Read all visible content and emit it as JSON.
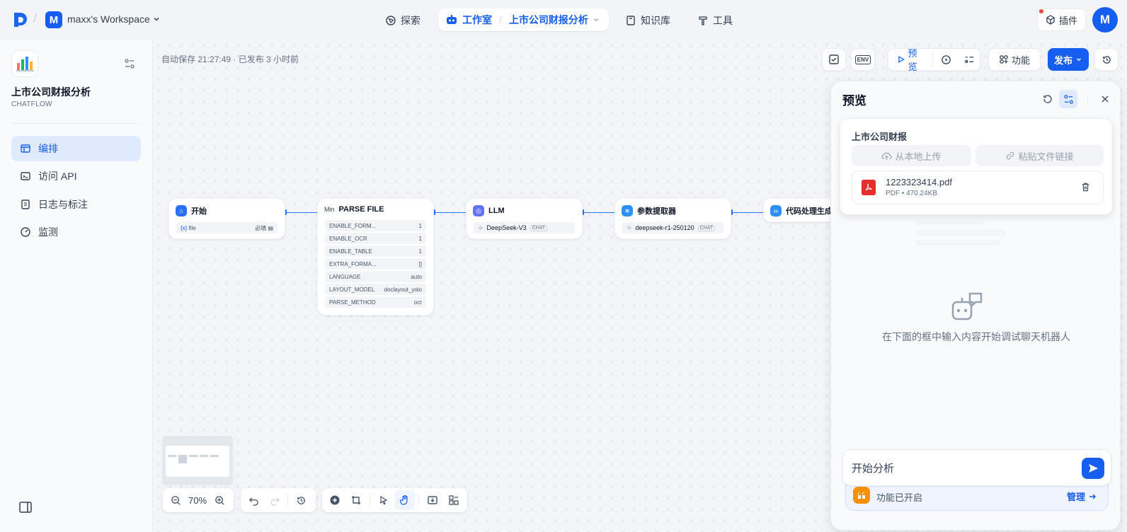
{
  "header": {
    "workspace_initial": "M",
    "workspace_name": "maxx's Workspace",
    "nav": {
      "explore": "探索",
      "studio": "工作室",
      "app_name": "上市公司财报分析",
      "knowledge": "知识库",
      "tools": "工具"
    },
    "plugin_label": "插件",
    "avatar_initial": "M"
  },
  "sidebar": {
    "app_title": "上市公司财报分析",
    "app_type": "CHATFLOW",
    "items": [
      {
        "label": "编排",
        "icon": "layout-icon"
      },
      {
        "label": "访问 API",
        "icon": "terminal-icon"
      },
      {
        "label": "日志与标注",
        "icon": "file-list-icon"
      },
      {
        "label": "监测",
        "icon": "dashboard-icon"
      }
    ]
  },
  "canvas": {
    "autosave": "自动保存 21:27:49 · 已发布 3 小时前",
    "toolbar": {
      "env": "ENV",
      "preview": "预览",
      "features": "功能",
      "publish": "发布"
    },
    "zoom": "70%"
  },
  "nodes": {
    "start": {
      "title": "开始",
      "var_prefix": "{x}",
      "var_name": "file",
      "required": "必填"
    },
    "parse": {
      "title": "PARSE FILE",
      "icon_text": "Min",
      "params": [
        {
          "key": "ENABLE_FORM...",
          "value": "1"
        },
        {
          "key": "ENABLE_OCR",
          "value": "1"
        },
        {
          "key": "ENABLE_TABLE",
          "value": "1"
        },
        {
          "key": "EXTRA_FORMA...",
          "value": "[]"
        },
        {
          "key": "LANGUAGE",
          "value": "auto"
        },
        {
          "key": "LAYOUT_MODEL",
          "value": "doclayout_yolo"
        },
        {
          "key": "PARSE_METHOD",
          "value": "ocr"
        }
      ]
    },
    "llm": {
      "title": "LLM",
      "model": "DeepSeek-V3",
      "tag": "CHAT"
    },
    "extractor": {
      "title": "参数提取器",
      "model": "deepseek-r1-250120",
      "tag": "CHAT"
    },
    "code": {
      "title": "代码处理生成"
    }
  },
  "preview": {
    "title": "预览",
    "upload_title": "上市公司财报",
    "upload_local": "从本地上传",
    "paste_link": "粘贴文件链接",
    "file_name": "1223323414.pdf",
    "file_meta": "PDF • 470.24KB",
    "empty_hint": "在下面的框中输入内容开始调试聊天机器人",
    "input_value": "开始分析",
    "features_enabled": "功能已开启",
    "manage": "管理"
  },
  "colors": {
    "accent": "#155eef",
    "edge": "#2970ff",
    "pdf_red": "#e62e2e",
    "feature_orange": "#f79009"
  }
}
